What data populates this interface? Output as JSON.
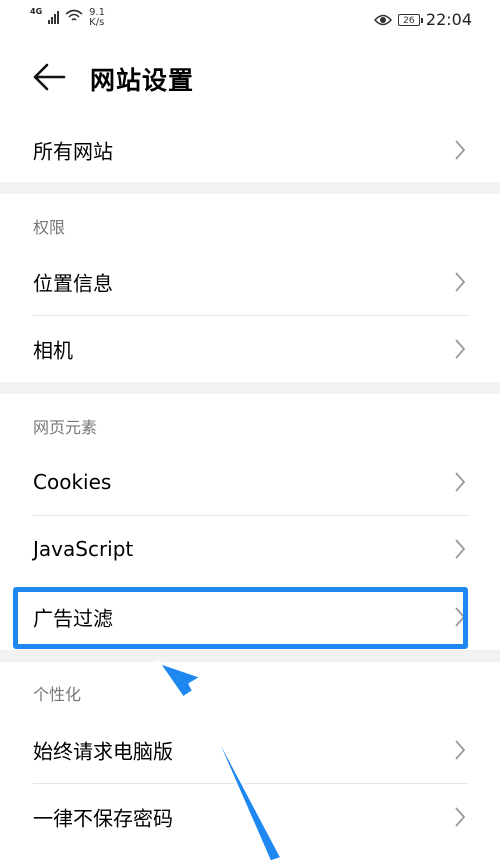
{
  "status_bar": {
    "network": "4G",
    "speed_value": "9.1",
    "speed_unit": "K/s",
    "battery": "26",
    "time": "22:04"
  },
  "header": {
    "title": "网站设置"
  },
  "items": {
    "all_sites": "所有网站",
    "location": "位置信息",
    "camera": "相机",
    "cookies": "Cookies",
    "javascript": "JavaScript",
    "ad_filter": "广告过滤",
    "desktop_version": "始终请求电脑版",
    "never_save_password": "一律不保存密码"
  },
  "sections": {
    "permissions": "权限",
    "page_elements": "网页元素",
    "personalization": "个性化"
  },
  "colors": {
    "highlight": "#1e88f0",
    "arrow": "#1e88f0",
    "section_gap": "#f2f2f2"
  }
}
